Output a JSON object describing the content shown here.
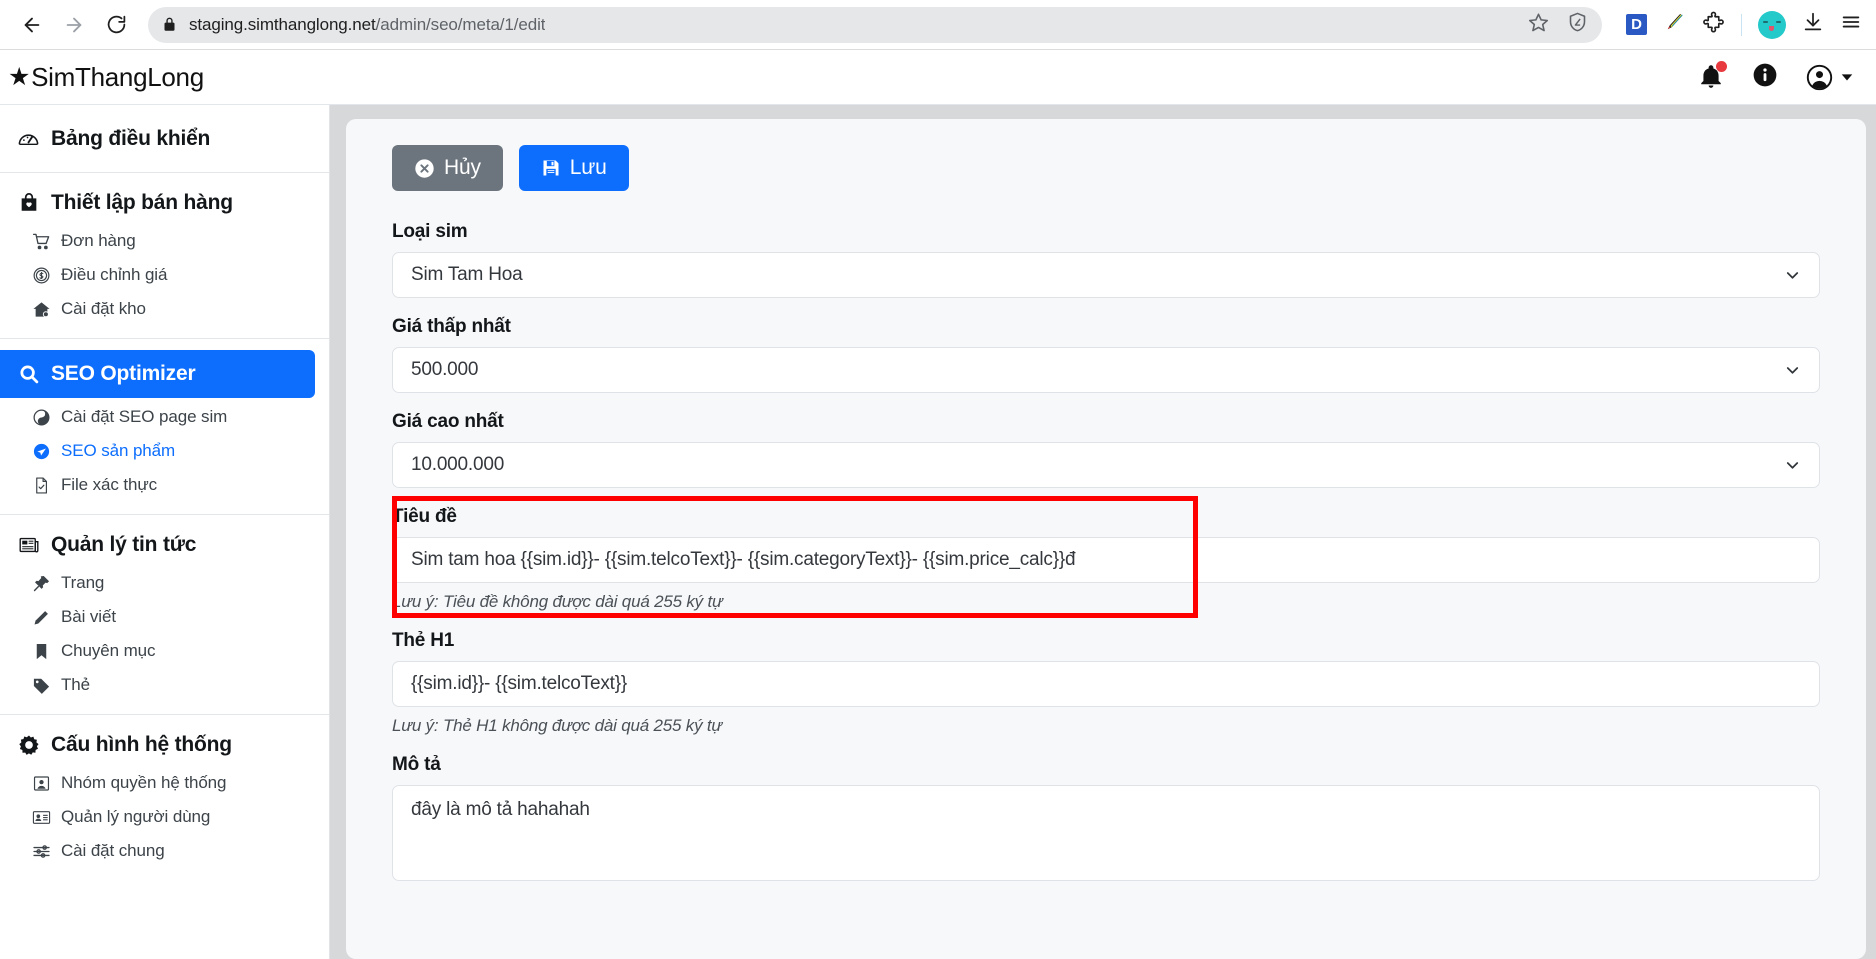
{
  "browser": {
    "url_host": "staging.simthanglong.net",
    "url_path": "/admin/seo/meta/1/edit",
    "back_icon": "back-arrow-icon",
    "forward_icon": "forward-arrow-icon",
    "reload_icon": "reload-icon",
    "lock_icon": "lock-icon",
    "bookmark_icon": "star-outline-icon",
    "shield_icon": "shield-icon",
    "extension_d_label": "D",
    "pen_icon": "colored-pen-icon",
    "puzzle_icon": "puzzle-piece-icon",
    "profile_icon": "profile-avatar-icon",
    "download_icon": "download-icon",
    "menu_icon": "hamburger-menu-icon"
  },
  "header": {
    "brand_star": "★",
    "brand_name": "SimThangLong",
    "notification_icon": "bell-icon",
    "info_icon": "info-icon",
    "account_icon": "account-circle-icon",
    "caret_icon": "caret-down-icon",
    "notification_dot_color": "#e8393f"
  },
  "sidebar": {
    "dashboard": {
      "label": "Bảng điều khiển",
      "icon": "dashboard-gauge-icon"
    },
    "groups": [
      {
        "label": "Thiết lập bán hàng",
        "icon": "shopping-bag-icon",
        "active": false,
        "items": [
          {
            "label": "Đơn hàng",
            "icon": "shopping-cart-icon",
            "active": false
          },
          {
            "label": "Điều chỉnh giá",
            "icon": "coin-dollar-icon",
            "active": false
          },
          {
            "label": "Cài đặt kho",
            "icon": "warehouse-icon",
            "active": false
          }
        ]
      },
      {
        "label": "SEO Optimizer",
        "icon": "magnifier-icon",
        "active": true,
        "items": [
          {
            "label": "Cài đặt SEO page sim",
            "icon": "contrast-circle-icon",
            "active": false
          },
          {
            "label": "SEO sản phẩm",
            "icon": "send-paper-plane-icon",
            "active": true
          },
          {
            "label": "File xác thực",
            "icon": "file-check-icon",
            "active": false
          }
        ]
      },
      {
        "label": "Quản lý tin tức",
        "icon": "newspaper-icon",
        "active": false,
        "items": [
          {
            "label": "Trang",
            "icon": "pushpin-icon",
            "active": false
          },
          {
            "label": "Bài viết",
            "icon": "pencil-icon",
            "active": false
          },
          {
            "label": "Chuyên mục",
            "icon": "bookmark-icon",
            "active": false
          },
          {
            "label": "Thẻ",
            "icon": "tag-icon",
            "active": false
          }
        ]
      },
      {
        "label": "Cấu hình hệ thống",
        "icon": "gear-icon",
        "active": false,
        "items": [
          {
            "label": "Nhóm quyền hệ thống",
            "icon": "user-badge-icon",
            "active": false
          },
          {
            "label": "Quản lý người dùng",
            "icon": "id-card-icon",
            "active": false
          },
          {
            "label": "Cài đặt chung",
            "icon": "sliders-icon",
            "active": false
          }
        ]
      }
    ]
  },
  "toolbar": {
    "cancel_label": "Hủy",
    "cancel_icon": "close-circle-icon",
    "save_label": "Lưu",
    "save_icon": "floppy-disk-icon"
  },
  "form": {
    "sim_type": {
      "label": "Loại sim",
      "value": "Sim Tam Hoa",
      "control": "select"
    },
    "min_price": {
      "label": "Giá thấp nhất",
      "value": "500.000",
      "control": "select"
    },
    "max_price": {
      "label": "Giá cao nhất",
      "value": "10.000.000",
      "control": "select"
    },
    "title": {
      "label": "Tiêu đề",
      "value": "Sim tam hoa {{sim.id}}- {{sim.telcoText}}- {{sim.categoryText}}- {{sim.price_calc}}đ",
      "hint": "Lưu ý: Tiêu đề không được dài quá 255 ký tự",
      "control": "text",
      "highlighted": true,
      "highlight_color": "#ff0000"
    },
    "h1_tag": {
      "label": "Thẻ H1",
      "value": "{{sim.id}}- {{sim.telcoText}}",
      "hint": "Lưu ý: Thẻ H1 không được dài quá 255 ký tự",
      "control": "text"
    },
    "description": {
      "label": "Mô tả",
      "value": "đây là mô tả hahahah",
      "control": "textarea"
    }
  },
  "colors": {
    "accent": "#0d6efd",
    "cancel": "#6c757d",
    "annotation": "#ff0000",
    "card_bg": "#f7f8fa"
  }
}
